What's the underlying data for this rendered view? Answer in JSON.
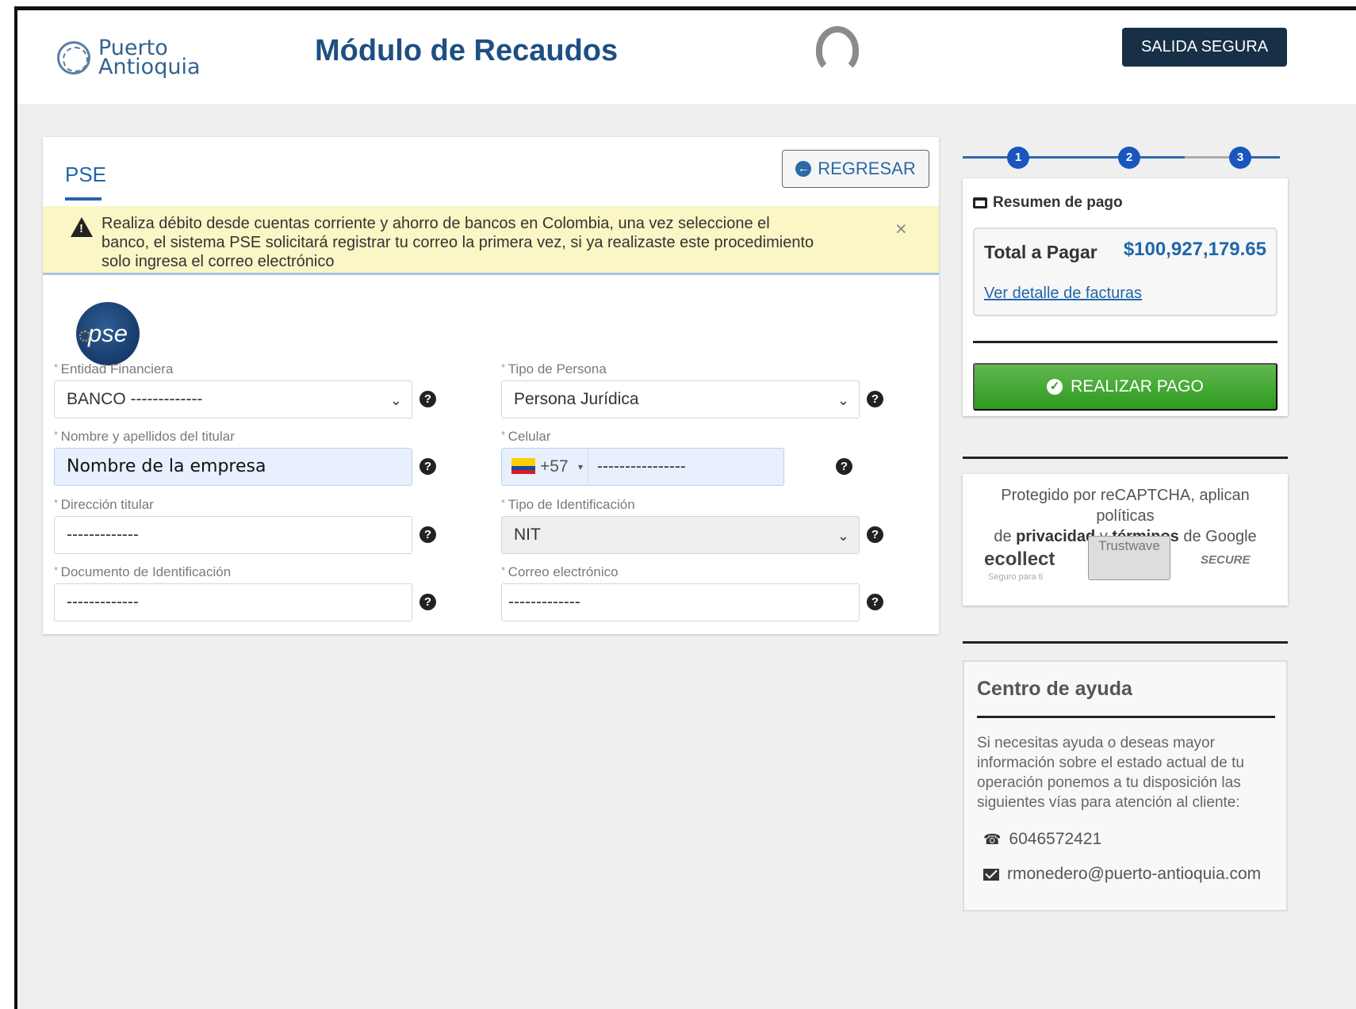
{
  "header": {
    "logo": {
      "line1": "Puerto",
      "line2": "Antioquia"
    },
    "title": "Módulo de Recaudos",
    "exit_button": "SALIDA SEGURA"
  },
  "form": {
    "tab": "PSE",
    "back_button": "REGRESAR",
    "alert": "Realiza débito desde cuentas corriente y ahorro de bancos en Colombia, una vez seleccione el banco, el sistema PSE solicitará registrar tu correo la primera vez, si ya realizaste este procedimiento solo ingresa el correo electrónico",
    "alert_close": "×",
    "pse_logo": "pse",
    "fields": {
      "bank": {
        "label": "Entidad Financiera",
        "value": "BANCO -------------"
      },
      "person_type": {
        "label": "Tipo de Persona",
        "value": "Persona Jurídica"
      },
      "holder_name": {
        "label": "Nombre y apellidos del titular",
        "value": "Nombre de la empresa"
      },
      "phone": {
        "label": "Celular",
        "dial_code": "+57",
        "value": "----------------"
      },
      "address": {
        "label": "Dirección titular",
        "value": "-------------"
      },
      "id_type": {
        "label": "Tipo de Identificación",
        "value": "NIT"
      },
      "id_document": {
        "label": "Documento de Identificación",
        "value": "-------------"
      },
      "email": {
        "label": "Correo electrónico",
        "value": "-------------"
      }
    }
  },
  "steps": [
    "1",
    "2",
    "3"
  ],
  "summary": {
    "title": "Resumen de pago",
    "total_label": "Total a Pagar",
    "total_value": "$100,927,179.65",
    "detail_link": "Ver detalle de facturas",
    "pay_button": "REALIZAR PAGO"
  },
  "captcha": {
    "line1": "Protegido por reCAPTCHA, aplican políticas",
    "line2_prefix": "de",
    "privacy": "privacidad",
    "line2_mid": "y",
    "terms": "términos",
    "line2_suffix": "de Google",
    "ecollect": "ecollect",
    "ecollect_sub": "Seguro para ti",
    "trustwave": "Trustwave",
    "secure": "SECURE"
  },
  "help": {
    "title": "Centro de ayuda",
    "text": "Si necesitas ayuda o deseas mayor información sobre el estado actual de tu operación ponemos a tu disposición las siguientes vías para atención al cliente:",
    "phone": "6046572421",
    "email": "rmonedero@puerto-antioquia.com"
  },
  "icons": {
    "question": "question-circle-icon",
    "back": "arrow-left-circle-icon",
    "check": "check-circle-icon",
    "cart": "cart-icon",
    "phone": "phone-icon",
    "mail": "mail-icon"
  },
  "colors": {
    "primary_blue": "#2166ab",
    "dark_navy": "#173047",
    "pay_green": "#2d9b1f",
    "alert_yellow": "#fbf6c5"
  }
}
